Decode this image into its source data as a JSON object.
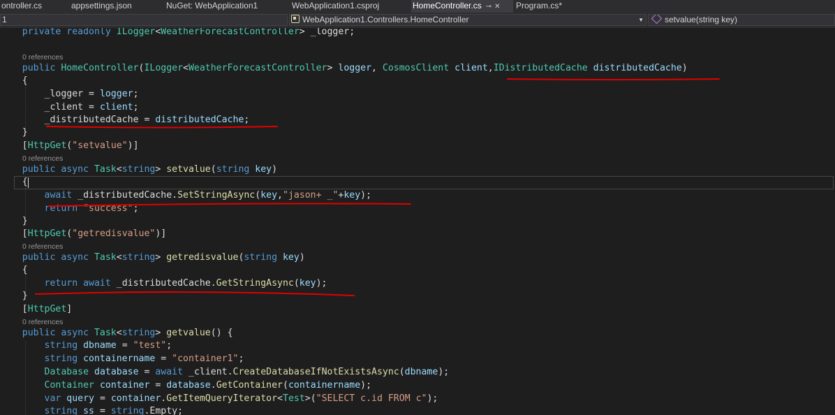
{
  "tabs": [
    {
      "label": "ontroller.cs",
      "active": false
    },
    {
      "label": "appsettings.json",
      "active": false
    },
    {
      "label": "NuGet: WebApplication1",
      "active": false
    },
    {
      "label": "WebApplication1.csproj",
      "active": false
    },
    {
      "label": "HomeController.cs",
      "active": true
    },
    {
      "label": "Program.cs*",
      "active": false
    }
  ],
  "navbar": {
    "project_combo": "1",
    "class_combo": "WebApplication1.Controllers.HomeController",
    "member_combo": "setvalue(string key)"
  },
  "icons": {
    "pin": "pin-icon",
    "close": "close-icon",
    "class": "class-icon",
    "method": "method-icon",
    "dropdown": "chevron-down-icon"
  },
  "code": {
    "l01": {
      "t1": "private readonly ",
      "t2": "ILogger",
      "t3": "<",
      "t4": "WeatherForecastController",
      "t5": "> _logger;"
    },
    "r1": "0 references",
    "l02": {
      "t1": "public ",
      "t2": "HomeController",
      "t3": "(",
      "t4": "ILogger",
      "t5": "<",
      "t6": "WeatherForecastController",
      "t7": "> ",
      "t8": "logger",
      "t9": ", ",
      "t10": "CosmosClient",
      "t11": " ",
      "t12": "client",
      "t13": ",",
      "t14": "IDistributedCache",
      "t15": " ",
      "t16": "distributedCache",
      "t17": ")"
    },
    "l03": {
      "t1": "{"
    },
    "l04": {
      "t1": "_logger = ",
      "t2": "logger",
      "t3": ";"
    },
    "l05": {
      "t1": "_client = ",
      "t2": "client",
      "t3": ";"
    },
    "l06": {
      "t1": "_distributedCache = ",
      "t2": "distributedCache",
      "t3": ";"
    },
    "l07": {
      "t1": "}"
    },
    "l08": {
      "t1": "[",
      "t2": "HttpGet",
      "t3": "(",
      "t4": "\"setvalue\"",
      "t5": ")]"
    },
    "r2": "0 references",
    "l09": {
      "t1": "public ",
      "t2": "async ",
      "t3": "Task",
      "t4": "<",
      "t5": "string",
      "t6": "> ",
      "t7": "setvalue",
      "t8": "(",
      "t9": "string ",
      "t10": "key",
      "t11": ")"
    },
    "l10": {
      "t1": "{"
    },
    "l11": {
      "t1": "await ",
      "t2": "_distributedCache.",
      "t3": "SetStringAsync",
      "t4": "(",
      "t5": "key",
      "t6": ",",
      "t7": "\"jason+ _\"",
      "t8": "+",
      "t9": "key",
      "t10": ");"
    },
    "l12": {
      "t1": "return ",
      "t2": "\"success\"",
      "t3": ";"
    },
    "l13": {
      "t1": "}"
    },
    "l14": {
      "t1": "[",
      "t2": "HttpGet",
      "t3": "(",
      "t4": "\"getredisvalue\"",
      "t5": ")]"
    },
    "r3": "0 references",
    "l15": {
      "t1": "public ",
      "t2": "async ",
      "t3": "Task",
      "t4": "<",
      "t5": "string",
      "t6": "> ",
      "t7": "getredisvalue",
      "t8": "(",
      "t9": "string ",
      "t10": "key",
      "t11": ")"
    },
    "l16": {
      "t1": "{"
    },
    "l17": {
      "t1": "return ",
      "t2": "await ",
      "t3": "_distributedCache.",
      "t4": "GetStringAsync",
      "t5": "(",
      "t6": "key",
      "t7": ");"
    },
    "l18": {
      "t1": "}"
    },
    "l19": {
      "t1": "[",
      "t2": "HttpGet",
      "t3": "]"
    },
    "r4": "0 references",
    "l20": {
      "t1": "public ",
      "t2": "async ",
      "t3": "Task",
      "t4": "<",
      "t5": "string",
      "t6": "> ",
      "t7": "getvalue",
      "t8": "() {"
    },
    "l21": {
      "t1": "string ",
      "t2": "dbname",
      "t3": " = ",
      "t4": "\"test\"",
      "t5": ";"
    },
    "l22": {
      "t1": "string ",
      "t2": "containername",
      "t3": " = ",
      "t4": "\"container1\"",
      "t5": ";"
    },
    "l23": {
      "t1": "Database ",
      "t2": "database",
      "t3": " = ",
      "t4": "await ",
      "t5": "_client.",
      "t6": "CreateDatabaseIfNotExistsAsync",
      "t7": "(",
      "t8": "dbname",
      "t9": ");"
    },
    "l24": {
      "t1": "Container ",
      "t2": "container",
      "t3": " = ",
      "t4": "database",
      "t5": ".",
      "t6": "GetContainer",
      "t7": "(",
      "t8": "containername",
      "t9": ");"
    },
    "l25": {
      "t1": "var ",
      "t2": "query",
      "t3": " = ",
      "t4": "container",
      "t5": ".",
      "t6": "GetItemQueryIterator",
      "t7": "<",
      "t8": "Test",
      "t9": ">(",
      "t10": "\"SELECT c.id FROM c\"",
      "t11": ");"
    },
    "l26": {
      "t1": "string ",
      "t2": "ss",
      "t3": " = ",
      "t4": "string",
      "t5": ".Empty;"
    }
  },
  "annotation_color": "#e00000"
}
